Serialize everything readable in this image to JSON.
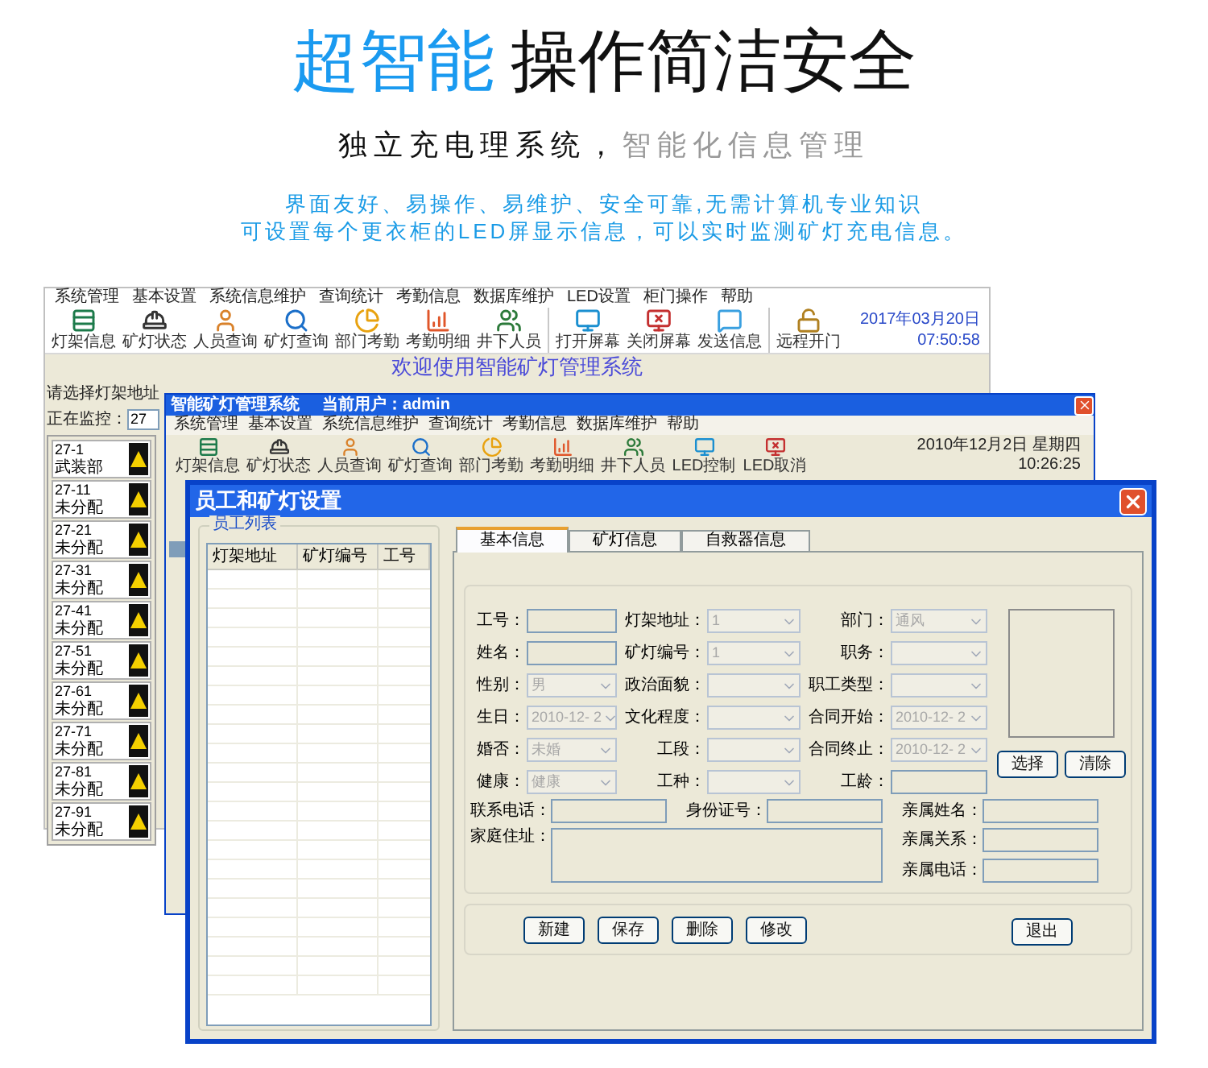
{
  "headline": {
    "highlight": "超智能",
    "rest": "操作简洁安全"
  },
  "subtitle": {
    "primary": "独立充电理系统，",
    "secondary": "智能化信息管理"
  },
  "description": [
    "界面友好、易操作、易维护、安全可靠,无需计算机专业知识",
    "可设置每个更衣柜的LED屏显示信息，可以实时监测矿灯充电信息。"
  ],
  "back_window": {
    "menu": [
      "系统管理",
      "基本设置",
      "系统信息维护",
      "查询统计",
      "考勤信息",
      "数据库维护",
      "LED设置",
      "柜门操作",
      "帮助"
    ],
    "toolbar_groups": [
      [
        {
          "label": "灯架信息",
          "kind": "rack"
        },
        {
          "label": "矿灯状态",
          "kind": "lamp"
        },
        {
          "label": "人员查询",
          "kind": "person"
        },
        {
          "label": "矿灯查询",
          "kind": "search"
        },
        {
          "label": "部门考勤",
          "kind": "pie"
        },
        {
          "label": "考勤明细",
          "kind": "bars"
        },
        {
          "label": "井下人员",
          "kind": "people"
        }
      ],
      [
        {
          "label": "打开屏幕",
          "kind": "monitor"
        },
        {
          "label": "关闭屏幕",
          "kind": "monitor-off"
        },
        {
          "label": "发送信息",
          "kind": "chat"
        }
      ],
      [
        {
          "label": "远程开门",
          "kind": "lock"
        }
      ]
    ],
    "date": "2017年03月20日",
    "time": "07:50:58",
    "welcome": "欢迎使用智能矿灯管理系统",
    "address_group": "请选择灯架地址",
    "monitor_label": "正在监控：",
    "monitor_value": "27",
    "racks": [
      {
        "code": "27-1",
        "status": "武装部"
      },
      {
        "code": "27-11",
        "status": "未分配"
      },
      {
        "code": "27-21",
        "status": "未分配"
      },
      {
        "code": "27-31",
        "status": "未分配"
      },
      {
        "code": "27-41",
        "status": "未分配"
      },
      {
        "code": "27-51",
        "status": "未分配"
      },
      {
        "code": "27-61",
        "status": "未分配"
      },
      {
        "code": "27-71",
        "status": "未分配"
      },
      {
        "code": "27-81",
        "status": "未分配"
      },
      {
        "code": "27-91",
        "status": "未分配"
      }
    ]
  },
  "front_window": {
    "title": "智能矿灯管理系统",
    "user": "当前用户：admin",
    "menu": [
      "系统管理",
      "基本设置",
      "系统信息维护",
      "查询统计",
      "考勤信息",
      "数据库维护",
      "帮助"
    ],
    "toolbar": [
      {
        "label": "灯架信息",
        "kind": "rack"
      },
      {
        "label": "矿灯状态",
        "kind": "lamp"
      },
      {
        "label": "人员查询",
        "kind": "person"
      },
      {
        "label": "矿灯查询",
        "kind": "search"
      },
      {
        "label": "部门考勤",
        "kind": "pie"
      },
      {
        "label": "考勤明细",
        "kind": "bars"
      },
      {
        "label": "井下人员",
        "kind": "people"
      },
      {
        "label": "LED控制",
        "kind": "monitor"
      },
      {
        "label": "LED取消",
        "kind": "monitor-off"
      }
    ],
    "date": "2010年12月2日 星期四",
    "time": "10:26:25"
  },
  "dialog": {
    "title": "员工和矿灯设置",
    "list_title": "员工列表",
    "columns": [
      "灯架地址",
      "矿灯编号",
      "工号"
    ],
    "tabs": [
      {
        "label": "基本信息",
        "selected": true
      },
      {
        "label": "矿灯信息",
        "selected": false
      },
      {
        "label": "自救器信息",
        "selected": false
      }
    ],
    "fields": [
      {
        "label": "工号：",
        "kind": "text"
      },
      {
        "label": "灯架地址：",
        "kind": "select",
        "value": "1"
      },
      {
        "label": "部门：",
        "kind": "select",
        "value": "通风"
      },
      {
        "label": "姓名：",
        "kind": "text"
      },
      {
        "label": "矿灯编号：",
        "kind": "select",
        "value": "1"
      },
      {
        "label": "职务：",
        "kind": "select"
      },
      {
        "label": "性别：",
        "kind": "select",
        "value": "男"
      },
      {
        "label": "政治面貌：",
        "kind": "select"
      },
      {
        "label": "职工类型：",
        "kind": "select"
      },
      {
        "label": "生日：",
        "kind": "select",
        "value": "2010-12- 2"
      },
      {
        "label": "文化程度：",
        "kind": "select"
      },
      {
        "label": "合同开始：",
        "kind": "select",
        "value": "2010-12- 2"
      },
      {
        "label": "婚否：",
        "kind": "select",
        "value": "未婚"
      },
      {
        "label": "工段：",
        "kind": "select"
      },
      {
        "label": "合同终止：",
        "kind": "select",
        "value": "2010-12- 2"
      },
      {
        "label": "健康：",
        "kind": "select",
        "value": "健康"
      },
      {
        "label": "工种：",
        "kind": "select"
      },
      {
        "label": "工龄：",
        "kind": "text"
      }
    ],
    "contact_fields": [
      "联系电话：",
      "身份证号：",
      "亲属姓名："
    ],
    "address_label": "家庭住址：",
    "relative_fields": [
      "亲属关系：",
      "亲属电话："
    ],
    "photo_buttons": [
      "选择",
      "清除"
    ],
    "actions": [
      "新建",
      "保存",
      "删除",
      "修改"
    ],
    "exit": "退出"
  }
}
